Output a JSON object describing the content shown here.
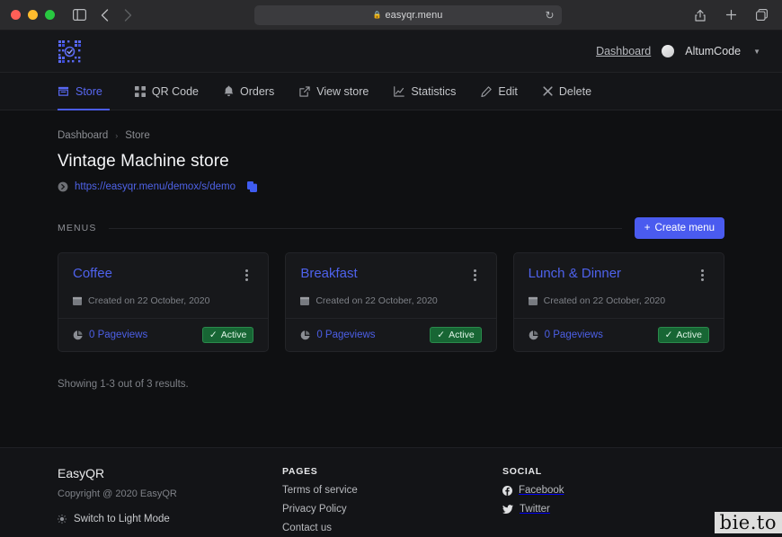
{
  "browser": {
    "url": "easyqr.menu",
    "lock_icon": "lock-icon",
    "reload_icon": "reload-icon",
    "back_icon": "back-arrow-icon",
    "forward_icon": "forward-arrow-icon",
    "sidebar_icon": "sidebar-toggle-icon",
    "reader_icon": "reader-view-icon",
    "share_icon": "share-icon",
    "newtab_icon": "new-tab-icon",
    "tabs_icon": "tab-overview-icon"
  },
  "header": {
    "logo_icon": "qr-code-logo-icon",
    "dashboard_link": "Dashboard",
    "user_name": "AltumCode",
    "avatar_icon": "avatar",
    "caret_icon": "chevron-down-icon"
  },
  "nav": {
    "tabs": [
      {
        "label": "Store",
        "icon": "store-icon",
        "active": true
      },
      {
        "label": "QR Code",
        "icon": "qr-code-icon",
        "active": false
      },
      {
        "label": "Orders",
        "icon": "bell-icon",
        "active": false
      },
      {
        "label": "View store",
        "icon": "external-link-icon",
        "active": false
      },
      {
        "label": "Statistics",
        "icon": "chart-icon",
        "active": false
      },
      {
        "label": "Edit",
        "icon": "pencil-icon",
        "active": false
      },
      {
        "label": "Delete",
        "icon": "close-icon",
        "active": false
      }
    ]
  },
  "main": {
    "breadcrumb": {
      "root": "Dashboard",
      "separator": "›",
      "current": "Store"
    },
    "page_title": "Vintage Machine store",
    "store_url": "https://easyqr.menu/demox/s/demo",
    "menus_label": "MENUS",
    "create_button": "Create menu",
    "create_button_icon": "plus-icon",
    "results_text": "Showing 1-3 out of 3 results.",
    "cards": [
      {
        "title": "Coffee",
        "created": "Created on 22 October, 2020",
        "pageviews": "0 Pageviews",
        "status": "Active"
      },
      {
        "title": "Breakfast",
        "created": "Created on 22 October, 2020",
        "pageviews": "0 Pageviews",
        "status": "Active"
      },
      {
        "title": "Lunch & Dinner",
        "created": "Created on 22 October, 2020",
        "pageviews": "0 Pageviews",
        "status": "Active"
      }
    ]
  },
  "footer": {
    "brand": "EasyQR",
    "copyright": "Copyright @ 2020 EasyQR",
    "mode_toggle": "Switch to Light Mode",
    "pages_heading": "PAGES",
    "pages_links": [
      "Terms of service",
      "Privacy Policy",
      "Contact us"
    ],
    "social_heading": "SOCIAL",
    "social_links": [
      {
        "label": "Facebook",
        "icon": "facebook-icon"
      },
      {
        "label": "Twitter",
        "icon": "twitter-icon"
      }
    ]
  },
  "watermark": "bie.to",
  "colors": {
    "accent_blue": "#4a5bef",
    "link_blue": "#4e62ec",
    "status_green": "#176634",
    "page_bg": "#0f1012",
    "card_bg": "#17181b"
  }
}
